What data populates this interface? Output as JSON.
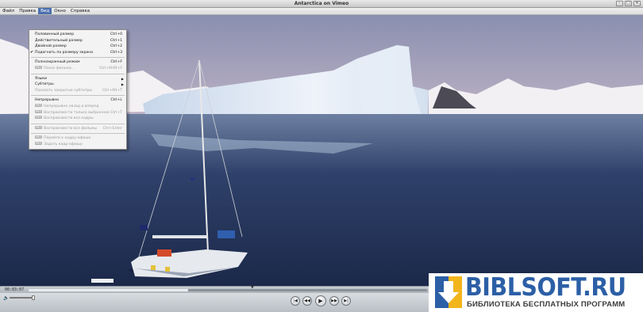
{
  "window": {
    "title": "Antarctica on Vimeo",
    "buttons": [
      "–",
      "□",
      "✕"
    ]
  },
  "menubar": [
    {
      "label": "Файл"
    },
    {
      "label": "Правка"
    },
    {
      "label": "Вид",
      "active": true
    },
    {
      "label": "Окно"
    },
    {
      "label": "Справка"
    }
  ],
  "view_menu": {
    "items": [
      {
        "label": "Половинный размер",
        "shortcut": "Ctrl+0"
      },
      {
        "label": "Действительный размер",
        "shortcut": "Ctrl+1"
      },
      {
        "label": "Двойной размер",
        "shortcut": "Ctrl+2"
      },
      {
        "label": "Подогнать по размеру экрана",
        "shortcut": "Ctrl+3",
        "checked": true
      },
      {
        "sep": true
      },
      {
        "label": "Полноэкранный режим",
        "shortcut": "Ctrl+F"
      },
      {
        "label": "Показ фильма...",
        "shortcut": "Ctrl+Shift+F",
        "disabled": true,
        "pro": true
      },
      {
        "sep": true
      },
      {
        "label": "Языки",
        "submenu": true
      },
      {
        "label": "Субтитры",
        "submenu": true
      },
      {
        "label": "Показать закрытые субтитры",
        "shortcut": "Ctrl+Alt+T",
        "disabled": true
      },
      {
        "sep": true
      },
      {
        "label": "Непрерывно",
        "shortcut": "Ctrl+L"
      },
      {
        "label": "Непрерывно назад и вперед",
        "disabled": true,
        "pro": true
      },
      {
        "label": "Воспроизвести только выбранное",
        "shortcut": "Ctrl+T",
        "disabled": true,
        "pro": true
      },
      {
        "label": "Воспроизвести все кадры",
        "disabled": true,
        "pro": true
      },
      {
        "sep": true
      },
      {
        "label": "Воспроизвести все фильмы",
        "shortcut": "Ctrl+Enter",
        "disabled": true,
        "pro": true
      },
      {
        "sep": true
      },
      {
        "label": "Перейти к кадру-афише",
        "disabled": true,
        "pro": true
      },
      {
        "label": "Задать кадр-афишу",
        "disabled": true,
        "pro": true
      }
    ],
    "pro_badge": "PRO"
  },
  "player": {
    "timecode": "00:03:07",
    "progress": 0.4,
    "playhead_icon": "▼",
    "volume": 0.9,
    "volume_icon": "speaker-icon",
    "buttons": [
      {
        "name": "go-to-start-button",
        "glyph": "|◀"
      },
      {
        "name": "rewind-button",
        "glyph": "◀◀"
      },
      {
        "name": "play-button",
        "glyph": "▶"
      },
      {
        "name": "fast-forward-button",
        "glyph": "▶▶"
      },
      {
        "name": "go-to-end-button",
        "glyph": "▶|"
      }
    ]
  },
  "watermark": {
    "main": "BIBLSOFT.RU",
    "sub": "БИБЛИОТЕКА БЕСПЛАТНЫХ ПРОГРАММ",
    "brand_color": "#2c5fa6"
  }
}
